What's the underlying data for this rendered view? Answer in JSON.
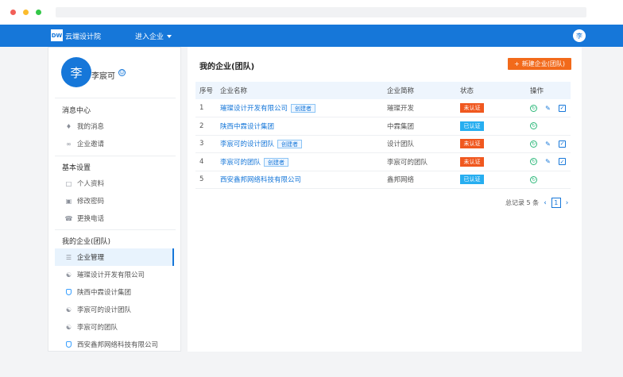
{
  "topnav": {
    "logo": "DW",
    "brand": "云端设计院",
    "enter_company": "进入企业",
    "avatar": "李"
  },
  "user": {
    "avatar": "李",
    "name": "李宸可"
  },
  "sidebar": {
    "msg_center": "消息中心",
    "msg_items": [
      "我的消息",
      "企业邀请"
    ],
    "basic_settings": "基本设置",
    "basic_items": [
      "个人资料",
      "修改密码",
      "更换电话"
    ],
    "my_company": "我的企业(团队)",
    "company_items": [
      "企业管理",
      "璀璨设计开发有限公司",
      "陕西中霖设计集团",
      "李宸可的设计团队",
      "李宸可的团队",
      "西安鑫邦网络科技有限公司"
    ]
  },
  "main": {
    "title": "我的企业(团队)",
    "new_button": "新建企业(团队)",
    "columns": [
      "序号",
      "企业名称",
      "企业简称",
      "状态",
      "操作"
    ],
    "rows": [
      {
        "no": "1",
        "name": "璀璨设计开发有限公司",
        "tag": "创建者",
        "short": "璀璨开发",
        "status": "未认证",
        "ok": false,
        "full_ops": true
      },
      {
        "no": "2",
        "name": "陕西中霖设计集团",
        "tag": "",
        "short": "中霖集团",
        "status": "已认证",
        "ok": true,
        "full_ops": false
      },
      {
        "no": "3",
        "name": "李宸可的设计团队",
        "tag": "创建者",
        "short": "设计团队",
        "status": "未认证",
        "ok": false,
        "full_ops": true
      },
      {
        "no": "4",
        "name": "李宸可的团队",
        "tag": "创建者",
        "short": "李宸可的团队",
        "status": "未认证",
        "ok": false,
        "full_ops": true
      },
      {
        "no": "5",
        "name": "西安鑫邦网络科技有限公司",
        "tag": "",
        "short": "鑫邦网络",
        "status": "已认证",
        "ok": true,
        "full_ops": false
      }
    ],
    "pager": {
      "total": "总记录 5 条",
      "page": "1"
    }
  },
  "colors": {
    "primary": "#1677d9",
    "orange": "#f26a1b",
    "unverified": "#f0581f",
    "verified": "#27aef0"
  },
  "icons": [
    "bell-icon",
    "link-icon",
    "doc-icon",
    "lock-icon",
    "phone-icon",
    "list-icon",
    "people-icon",
    "shield-icon",
    "clock-icon",
    "edit-icon",
    "check-icon"
  ]
}
